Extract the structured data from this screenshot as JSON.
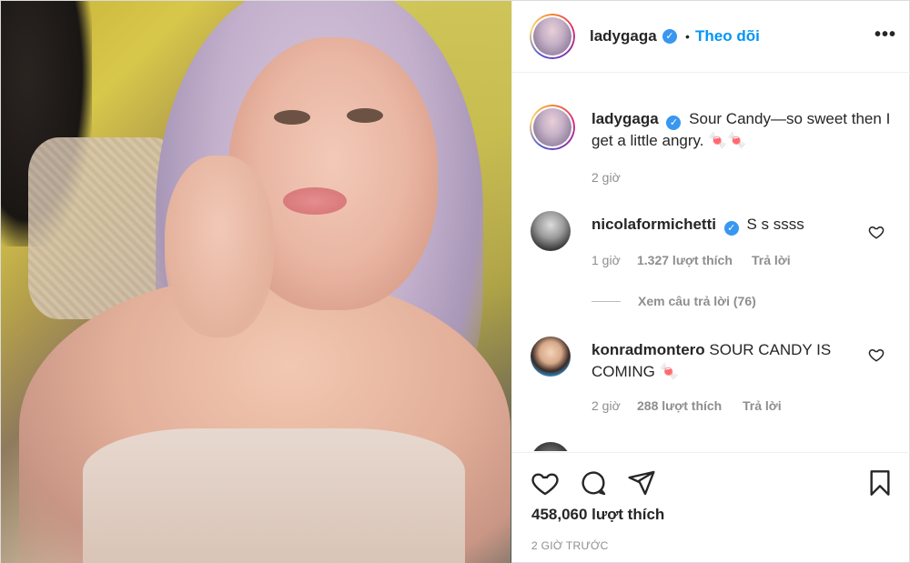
{
  "header": {
    "username": "ladygaga",
    "dot": "•",
    "follow_label": "Theo dõi",
    "more_label": "•••"
  },
  "caption": {
    "username": "ladygaga",
    "text": "Sour Candy—so sweet then I get a little angry. 🍬🍬",
    "time": "2 giờ"
  },
  "comments": [
    {
      "username": "nicolaformichetti",
      "text": "S s ssss",
      "time": "1 giờ",
      "likes": "1.327 lượt thích",
      "reply": "Trả lời",
      "view_replies": "Xem câu trả lời (76)"
    },
    {
      "username": "konradmontero",
      "text": "SOUR CANDY IS COMING 🍬",
      "time": "2 giờ",
      "likes": "288 lượt thích",
      "reply": "Trả lời"
    }
  ],
  "footer": {
    "likes": "458,060 lượt thích",
    "time": "2 GIỜ TRƯỚC"
  },
  "icons": [
    "heart-icon",
    "comment-icon",
    "share-icon",
    "bookmark-icon",
    "verified-icon",
    "more-icon"
  ],
  "colors": {
    "accent": "#0095f6",
    "verified": "#3897f0",
    "muted": "#8e8e8e",
    "text": "#262626"
  }
}
